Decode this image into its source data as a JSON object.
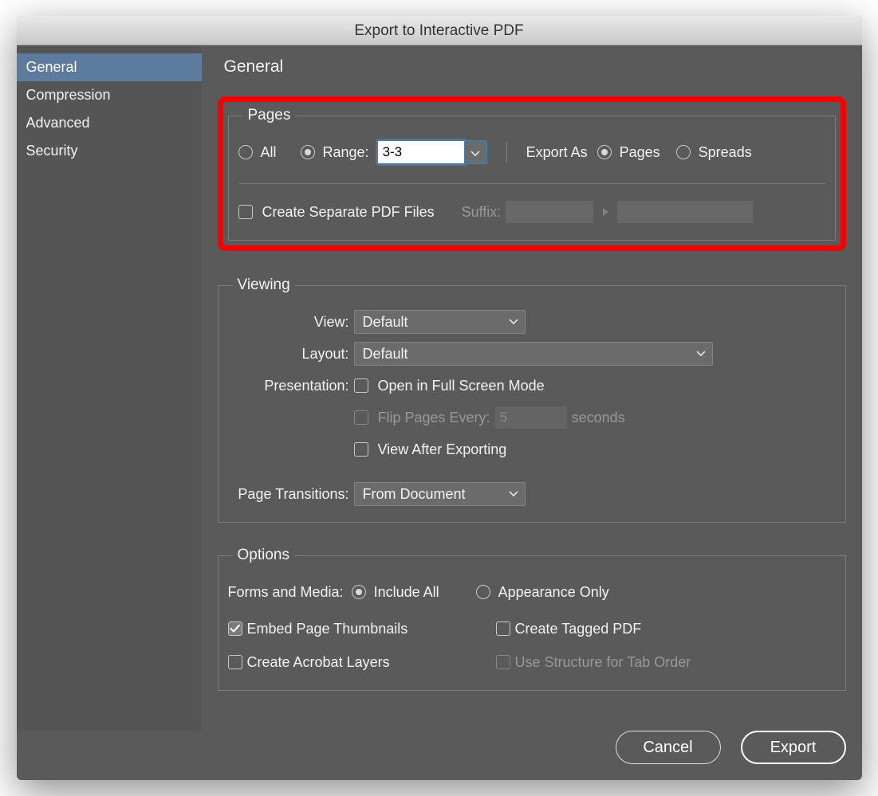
{
  "title": "Export to Interactive PDF",
  "sidebar": {
    "items": [
      {
        "label": "General",
        "selected": true
      },
      {
        "label": "Compression",
        "selected": false
      },
      {
        "label": "Advanced",
        "selected": false
      },
      {
        "label": "Security",
        "selected": false
      }
    ]
  },
  "main": {
    "heading": "General",
    "pages": {
      "legend": "Pages",
      "all_label": "All",
      "all_selected": false,
      "range_label": "Range:",
      "range_selected": true,
      "range_value": "3-3",
      "export_as_label": "Export As",
      "pages_label": "Pages",
      "pages_selected": true,
      "spreads_label": "Spreads",
      "spreads_selected": false,
      "create_separate_label": "Create Separate PDF Files",
      "create_separate_checked": false,
      "suffix_label": "Suffix:",
      "suffix_value_1": "",
      "suffix_value_2": ""
    },
    "viewing": {
      "legend": "Viewing",
      "view_label": "View:",
      "view_value": "Default",
      "layout_label": "Layout:",
      "layout_value": "Default",
      "presentation_label": "Presentation:",
      "open_full_screen_label": "Open in Full Screen Mode",
      "open_full_screen_checked": false,
      "flip_pages_label": "Flip Pages Every:",
      "flip_pages_value": "5",
      "flip_pages_unit": "seconds",
      "flip_pages_enabled": false,
      "view_after_export_label": "View After Exporting",
      "view_after_export_checked": false,
      "page_transitions_label": "Page Transitions:",
      "page_transitions_value": "From Document"
    },
    "options": {
      "legend": "Options",
      "forms_media_label": "Forms and Media:",
      "include_all_label": "Include All",
      "include_all_selected": true,
      "appearance_only_label": "Appearance Only",
      "appearance_only_selected": false,
      "embed_thumbnails_label": "Embed Page Thumbnails",
      "embed_thumbnails_checked": true,
      "create_tagged_label": "Create Tagged PDF",
      "create_tagged_checked": false,
      "create_acrobat_layers_label": "Create Acrobat Layers",
      "create_acrobat_layers_checked": false,
      "use_structure_label": "Use Structure for Tab Order",
      "use_structure_enabled": false
    }
  },
  "footer": {
    "cancel_label": "Cancel",
    "export_label": "Export"
  }
}
